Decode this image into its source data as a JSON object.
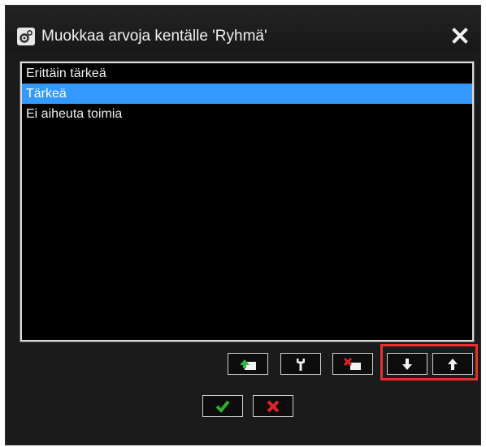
{
  "dialog": {
    "title": "Muokkaa arvoja kentälle 'Ryhmä'",
    "title_icon": "gear-icon",
    "close_icon": "close-icon"
  },
  "list": {
    "items": [
      {
        "label": "Erittäin tärkeä",
        "selected": false
      },
      {
        "label": "Tärkeä",
        "selected": true
      },
      {
        "label": "Ei aiheuta toimia",
        "selected": false
      }
    ],
    "selection_color": "#3399ff"
  },
  "toolbar": {
    "buttons": [
      {
        "name": "add-value-button",
        "icon": "add-icon"
      },
      {
        "name": "edit-value-button",
        "icon": "wrench-icon"
      },
      {
        "name": "delete-value-button",
        "icon": "delete-icon"
      },
      {
        "name": "move-down-button",
        "icon": "arrow-down-icon"
      },
      {
        "name": "move-up-button",
        "icon": "arrow-up-icon"
      }
    ],
    "highlight_color": "#e8302f"
  },
  "footer": {
    "buttons": [
      {
        "name": "ok-button",
        "icon": "checkmark-icon",
        "color": "#2db12d"
      },
      {
        "name": "cancel-button",
        "icon": "x-icon",
        "color": "#e02424"
      }
    ]
  }
}
